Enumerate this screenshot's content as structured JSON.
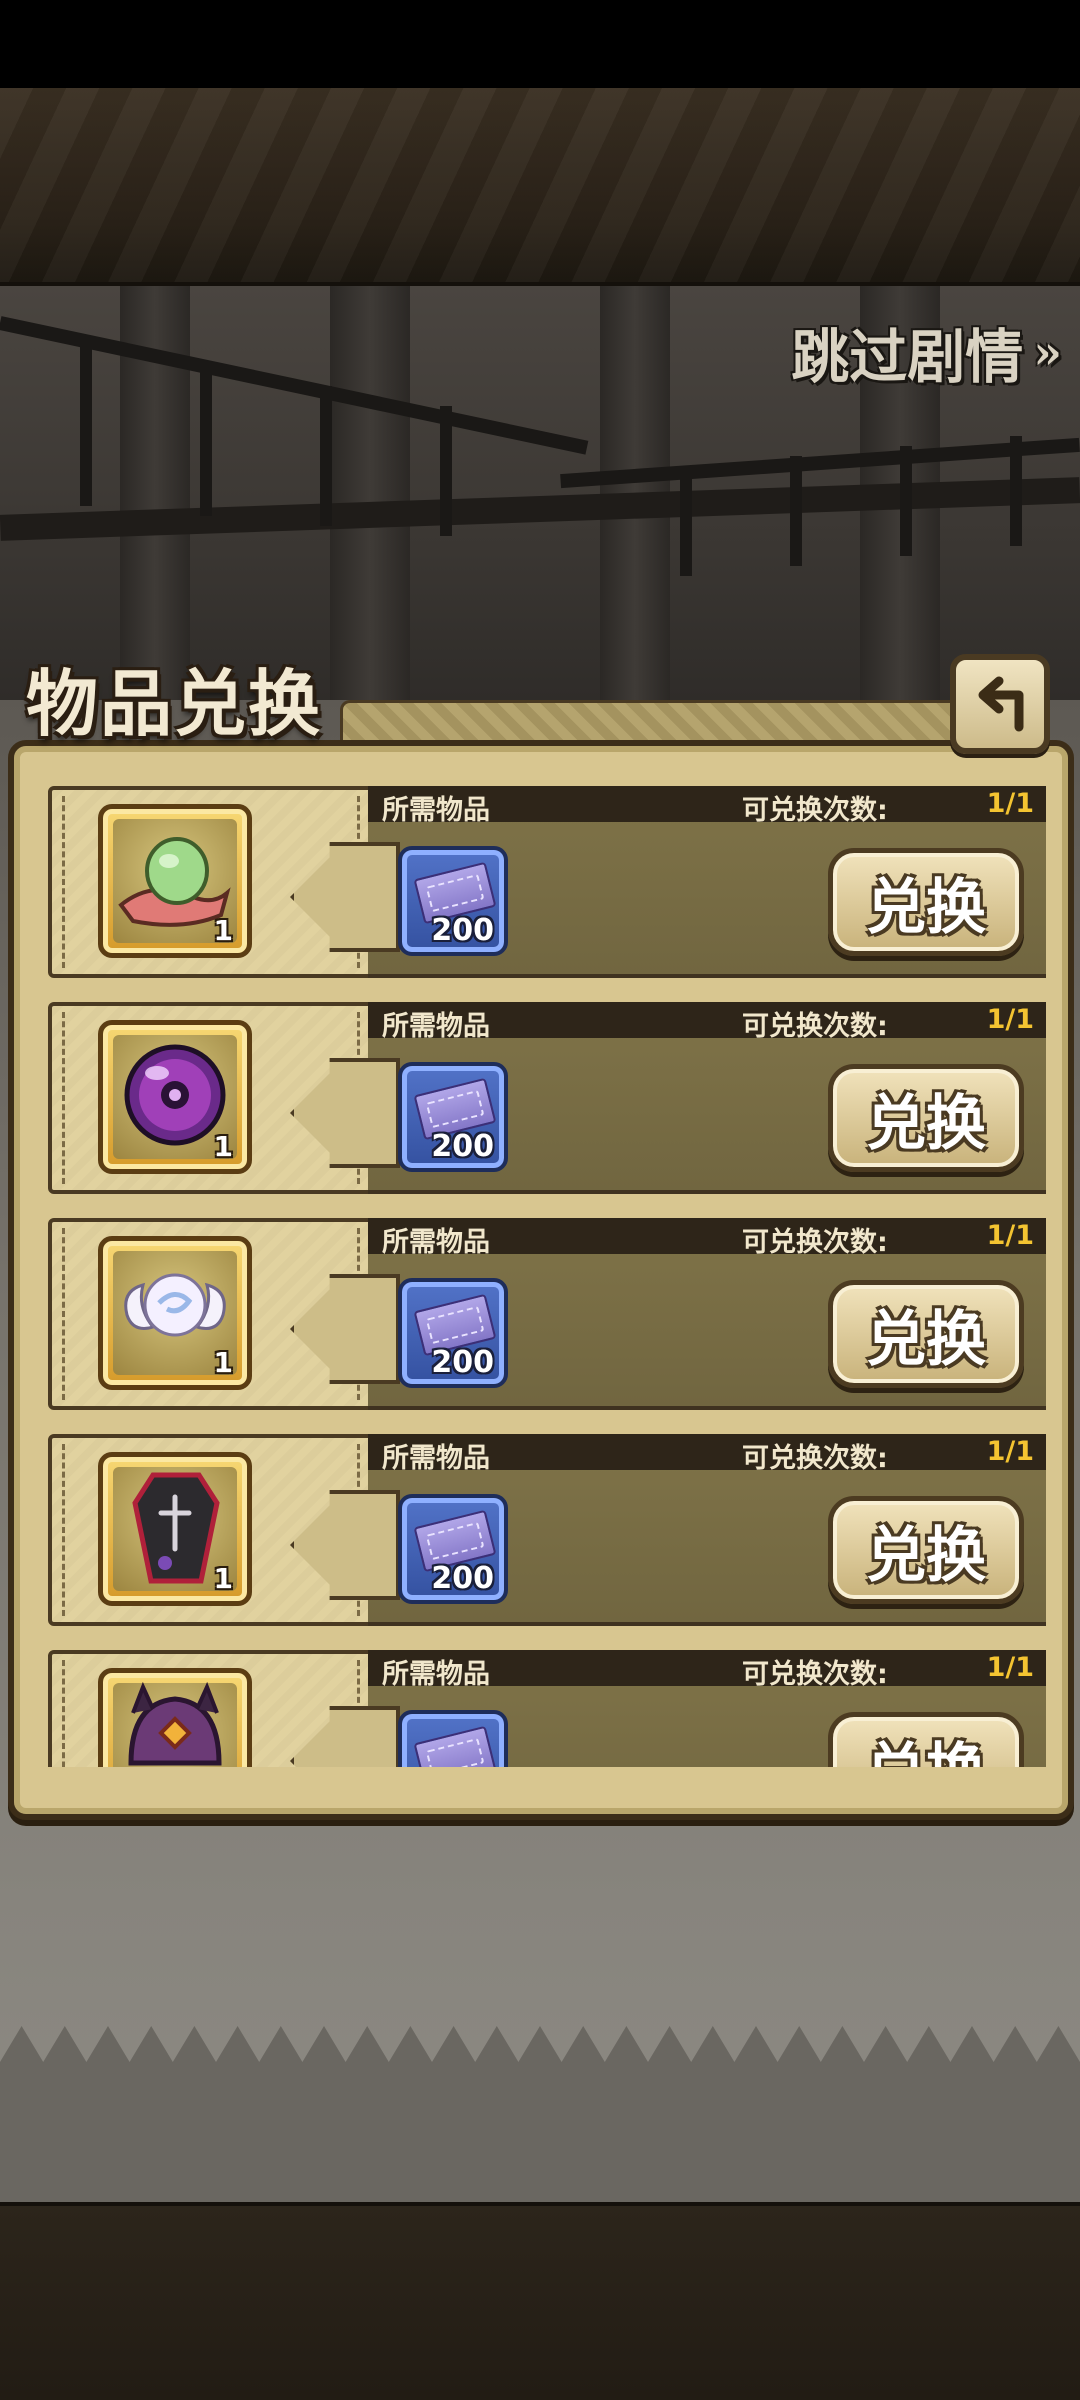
{
  "skip_story": {
    "label": "跳过剧情",
    "chevrons": "»"
  },
  "panel": {
    "title": "物品兑换"
  },
  "rows": [
    {
      "required_label": "所需物品",
      "count_label": "可兑换次数:",
      "count_value": "1/1",
      "item": {
        "icon": "green-egg-on-cloth-icon",
        "qty": "1"
      },
      "cost": {
        "icon": "purple-ticket-icon",
        "qty": "200"
      },
      "button_label": "兑换"
    },
    {
      "required_label": "所需物品",
      "count_label": "可兑换次数:",
      "count_value": "1/1",
      "item": {
        "icon": "purple-orb-icon",
        "qty": "1"
      },
      "cost": {
        "icon": "purple-ticket-icon",
        "qty": "200"
      },
      "button_label": "兑换"
    },
    {
      "required_label": "所需物品",
      "count_label": "可兑换次数:",
      "count_value": "1/1",
      "item": {
        "icon": "winged-pearl-icon",
        "qty": "1"
      },
      "cost": {
        "icon": "purple-ticket-icon",
        "qty": "200"
      },
      "button_label": "兑换"
    },
    {
      "required_label": "所需物品",
      "count_label": "可兑换次数:",
      "count_value": "1/1",
      "item": {
        "icon": "coffin-icon",
        "qty": "1"
      },
      "cost": {
        "icon": "purple-ticket-icon",
        "qty": "200"
      },
      "button_label": "兑换"
    },
    {
      "required_label": "所需物品",
      "count_label": "可兑换次数:",
      "count_value": "1/1",
      "item": {
        "icon": "demon-helmet-icon",
        "qty": ""
      },
      "cost": {
        "icon": "purple-ticket-icon",
        "qty": ""
      },
      "button_label": "兑换"
    }
  ]
}
